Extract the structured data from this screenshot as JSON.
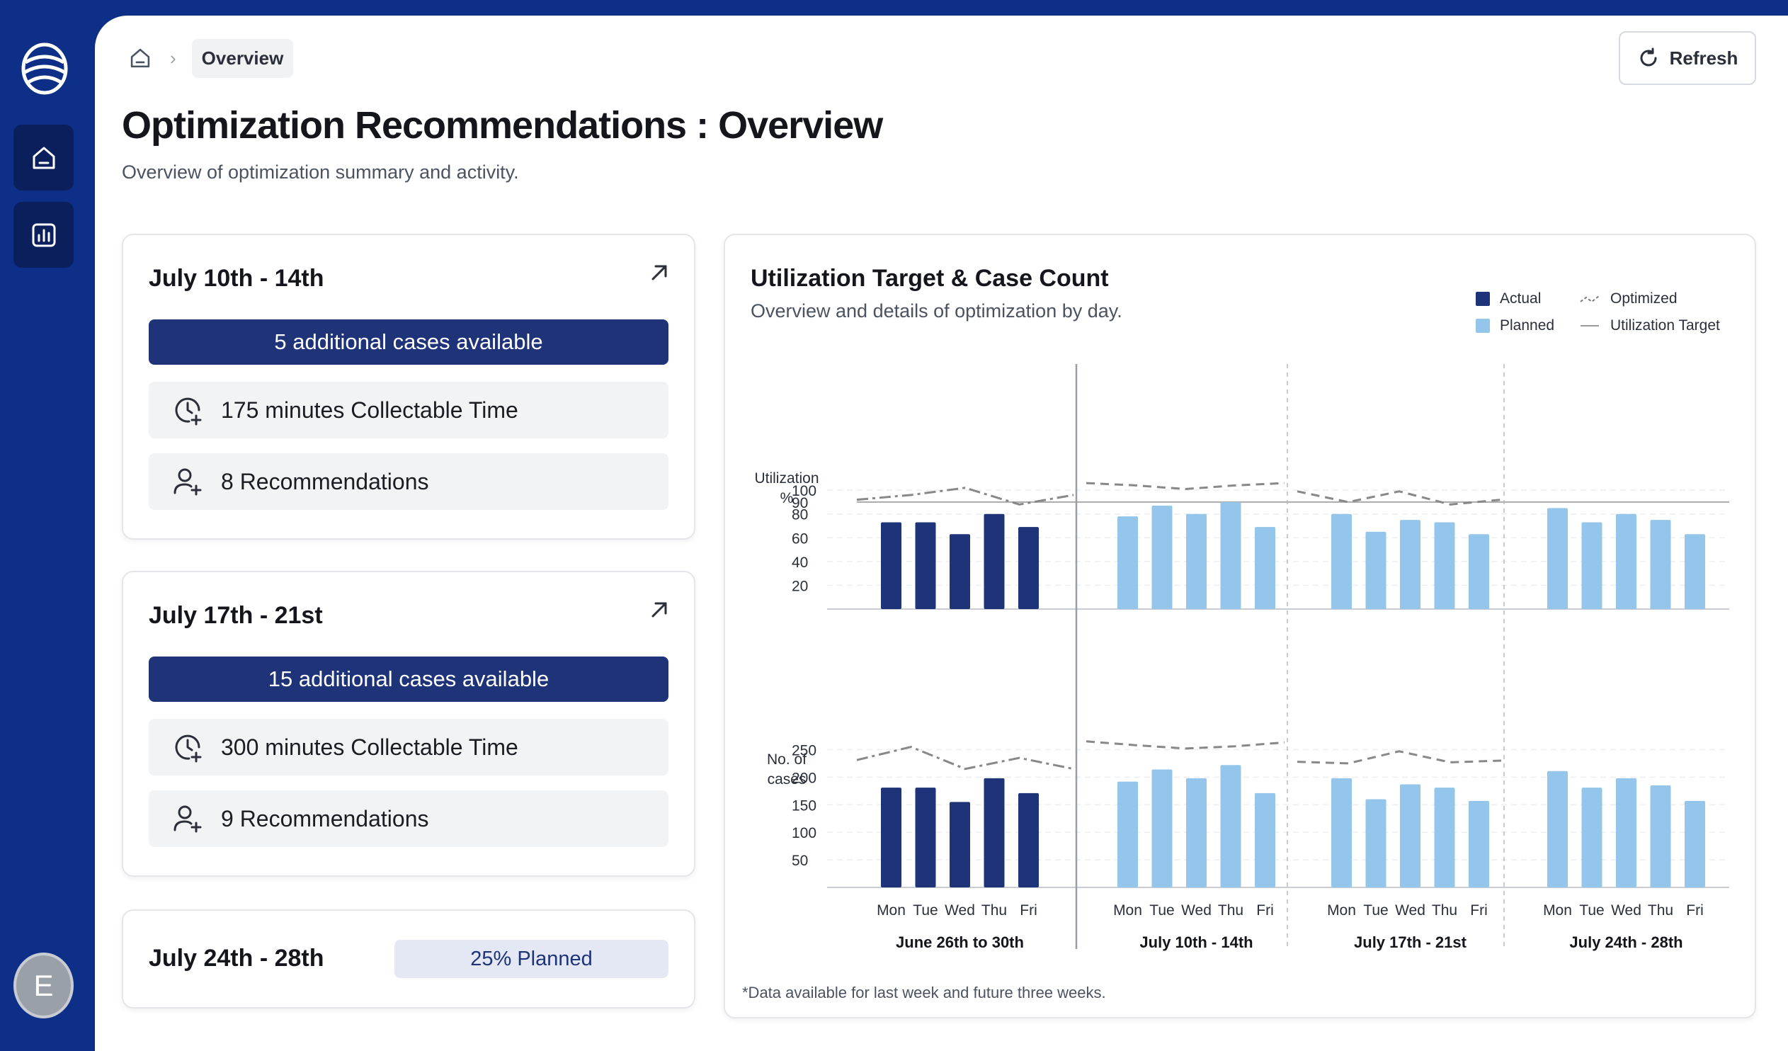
{
  "sidebar": {
    "items": [
      {
        "icon": "home-icon",
        "label": "Home"
      },
      {
        "icon": "chart-icon",
        "label": "Reports"
      }
    ],
    "avatar_initial": "E"
  },
  "breadcrumb": {
    "home_icon": "home-icon",
    "current": "Overview"
  },
  "header": {
    "title": "Optimization Recommendations : Overview",
    "subtitle": "Overview of optimization summary and activity.",
    "refresh_label": "Refresh"
  },
  "cards": [
    {
      "title": "July 10th - 14th",
      "banner": "5 additional cases available",
      "collectable": "175 minutes Collectable Time",
      "recommendations": "8 Recommendations"
    },
    {
      "title": "July 17th - 21st",
      "banner": "15 additional cases available",
      "collectable": "300 minutes Collectable Time",
      "recommendations": "9 Recommendations"
    },
    {
      "title": "July 24th - 28th",
      "badge": "25% Planned"
    }
  ],
  "chart": {
    "title": "Utilization Target & Case Count",
    "subtitle": "Overview and details of optimization by day.",
    "legend": {
      "actual": "Actual",
      "planned": "Planned",
      "optimized": "Optimized",
      "target": "Utilization Target"
    },
    "footnote": "*Data available for last week and future three weeks.",
    "colors": {
      "actual": "#1f3478",
      "planned": "#93c6ea",
      "optimized": "#888888",
      "target": "#aaaaaa"
    }
  },
  "chart_data": [
    {
      "type": "bar",
      "ylabel": "Utilization %",
      "yticks": [
        20,
        40,
        60,
        80,
        90,
        100
      ],
      "ylim": [
        0,
        112
      ],
      "target": 90,
      "days": [
        "Mon",
        "Tue",
        "Wed",
        "Thu",
        "Fri"
      ],
      "weeks": [
        {
          "label": "June 26th to 30th",
          "kind": "actual",
          "values": [
            73,
            73,
            63,
            80,
            69
          ],
          "optimized": [
            92,
            96,
            102,
            88,
            96
          ]
        },
        {
          "label": "July 10th - 14th",
          "kind": "planned",
          "values": [
            78,
            87,
            80,
            90,
            69
          ],
          "optimized": [
            106,
            104,
            101,
            104,
            106
          ]
        },
        {
          "label": "July 17th - 21st",
          "kind": "planned",
          "values": [
            80,
            65,
            75,
            73,
            63
          ],
          "optimized": [
            99,
            90,
            99,
            88,
            92
          ]
        },
        {
          "label": "July 24th - 28th",
          "kind": "planned",
          "values": [
            85,
            73,
            80,
            75,
            63
          ],
          "optimized": []
        }
      ]
    },
    {
      "type": "bar",
      "ylabel": "No. of cases",
      "yticks": [
        50,
        100,
        150,
        200,
        250
      ],
      "ylim": [
        0,
        275
      ],
      "days": [
        "Mon",
        "Tue",
        "Wed",
        "Thu",
        "Fri"
      ],
      "weeks": [
        {
          "label": "June 26th to 30th",
          "kind": "actual",
          "values": [
            181,
            181,
            155,
            198,
            171
          ],
          "optimized": [
            231,
            255,
            215,
            235,
            215
          ]
        },
        {
          "label": "July 10th - 14th",
          "kind": "planned",
          "values": [
            192,
            214,
            198,
            222,
            171
          ],
          "optimized": [
            265,
            258,
            252,
            256,
            263
          ]
        },
        {
          "label": "July 17th - 21st",
          "kind": "planned",
          "values": [
            198,
            160,
            187,
            181,
            157
          ],
          "optimized": [
            228,
            225,
            247,
            227,
            230
          ]
        },
        {
          "label": "July 24th - 28th",
          "kind": "planned",
          "values": [
            211,
            181,
            198,
            185,
            157
          ],
          "optimized": []
        }
      ]
    }
  ]
}
